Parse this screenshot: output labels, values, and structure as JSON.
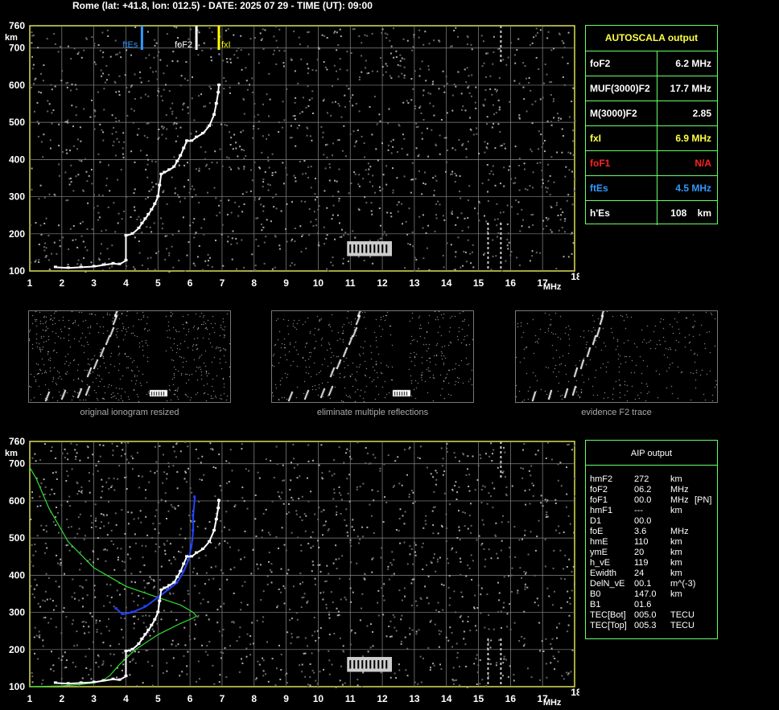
{
  "header": {
    "title": "Rome (lat: +41.8, lon: 012.5) - DATE: 2025 07 29 - TIME (UT): 09:00"
  },
  "axes": {
    "y_unit": "km",
    "x_unit": "MHz",
    "y_ticks": [
      "760",
      "700",
      "600",
      "500",
      "400",
      "300",
      "200",
      "100"
    ],
    "x_ticks": [
      "1",
      "2",
      "3",
      "4",
      "5",
      "6",
      "7",
      "8",
      "9",
      "10",
      "11",
      "12",
      "13",
      "14",
      "15",
      "16",
      "17",
      "18"
    ]
  },
  "markers": [
    {
      "label": "ftEs",
      "freq": 4.5,
      "color": "#3399ff"
    },
    {
      "label": "foF2",
      "freq": 6.2,
      "color": "#ffffff"
    },
    {
      "label": "fxI",
      "freq": 6.9,
      "color": "#ffff00"
    }
  ],
  "autoscala": {
    "title": "AUTOSCALA output",
    "rows": [
      {
        "label": "foF2",
        "value": "6.2 MHz",
        "color": "#ffffff"
      },
      {
        "label": "MUF(3000)F2",
        "value": "17.7 MHz",
        "color": "#ffffff"
      },
      {
        "label": "M(3000)F2",
        "value": "2.85",
        "color": "#ffffff"
      },
      {
        "label": "fxI",
        "value": "6.9 MHz",
        "color": "#ffff44"
      },
      {
        "label": "foF1",
        "value": "N/A",
        "color": "#ff2222"
      },
      {
        "label": "ftEs",
        "value": "4.5 MHz",
        "color": "#3399ff"
      },
      {
        "label": "h'Es",
        "value": "108    km",
        "color": "#ffffff"
      }
    ]
  },
  "thumbnails": [
    {
      "caption": "original ionogram resized"
    },
    {
      "caption": "eliminate multiple reflections"
    },
    {
      "caption": "evidence F2 trace"
    }
  ],
  "aip": {
    "title": "AIP output",
    "rows": [
      {
        "label": "hmF2",
        "value": "272",
        "unit": "km",
        "extra": ""
      },
      {
        "label": "foF2",
        "value": "06.2",
        "unit": "MHz",
        "extra": ""
      },
      {
        "label": "foF1",
        "value": "00.0",
        "unit": "MHz",
        "extra": "[PN]"
      },
      {
        "label": "hmF1",
        "value": "---",
        "unit": "km",
        "extra": ""
      },
      {
        "label": "D1",
        "value": "00.0",
        "unit": "",
        "extra": ""
      },
      {
        "label": "foE",
        "value": "3.6",
        "unit": "MHz",
        "extra": ""
      },
      {
        "label": "hmE",
        "value": "110",
        "unit": "km",
        "extra": ""
      },
      {
        "label": "ymE",
        "value": "20",
        "unit": "km",
        "extra": ""
      },
      {
        "label": "h_vE",
        "value": "119",
        "unit": "km",
        "extra": ""
      },
      {
        "label": "Ewidth",
        "value": "24",
        "unit": "km",
        "extra": ""
      },
      {
        "label": "DelN_vE",
        "value": "00.1",
        "unit": "m^(-3)",
        "extra": ""
      },
      {
        "label": "B0",
        "value": "147.0",
        "unit": "km",
        "extra": ""
      },
      {
        "label": "B1",
        "value": "01.6",
        "unit": "",
        "extra": ""
      },
      {
        "label": "TEC[Bot]",
        "value": "005.0",
        "unit": "TECU",
        "extra": ""
      },
      {
        "label": "TEC[Top]",
        "value": "005.3",
        "unit": "TECU",
        "extra": ""
      }
    ]
  },
  "chart_data": [
    {
      "type": "scatter",
      "xlim": [
        1,
        18
      ],
      "ylim": [
        100,
        760
      ],
      "grid": true,
      "series": [
        {
          "points": [
            [
              1.8,
              110
            ],
            [
              2.2,
              108
            ],
            [
              2.6,
              110
            ],
            [
              3.0,
              112
            ],
            [
              3.3,
              116
            ],
            [
              3.6,
              120
            ],
            [
              3.8,
              118
            ],
            [
              4.0,
              128
            ],
            [
              4.0,
              195
            ],
            [
              4.2,
              200
            ],
            [
              4.4,
              215
            ],
            [
              4.5,
              228
            ],
            [
              4.6,
              240
            ],
            [
              4.7,
              252
            ],
            [
              4.8,
              265
            ],
            [
              4.9,
              280
            ],
            [
              5.0,
              300
            ],
            [
              5.05,
              330
            ],
            [
              5.1,
              360
            ],
            [
              5.2,
              365
            ],
            [
              5.35,
              372
            ],
            [
              5.5,
              380
            ],
            [
              5.6,
              395
            ],
            [
              5.7,
              410
            ],
            [
              5.8,
              430
            ],
            [
              5.9,
              450
            ],
            [
              6.05,
              450
            ],
            [
              6.2,
              460
            ],
            [
              6.4,
              470
            ],
            [
              6.6,
              490
            ],
            [
              6.75,
              520
            ],
            [
              6.82,
              550
            ],
            [
              6.88,
              580
            ],
            [
              6.9,
              600
            ]
          ]
        }
      ]
    },
    {
      "type": "line",
      "xlim": [
        1,
        18
      ],
      "ylim": [
        100,
        760
      ],
      "grid": true,
      "series": [
        {
          "points": [
            [
              1.0,
              100
            ],
            [
              2.0,
              102
            ],
            [
              2.6,
              106
            ],
            [
              3.0,
              110
            ],
            [
              3.3,
              118
            ],
            [
              3.5,
              130
            ],
            [
              3.8,
              160
            ],
            [
              4.3,
              200
            ],
            [
              5.0,
              240
            ],
            [
              5.7,
              270
            ],
            [
              6.1,
              285
            ],
            [
              6.2,
              290
            ],
            [
              6.1,
              300
            ],
            [
              5.7,
              320
            ],
            [
              5.0,
              340
            ],
            [
              4.0,
              370
            ],
            [
              3.0,
              420
            ],
            [
              2.2,
              490
            ],
            [
              1.6,
              580
            ],
            [
              1.2,
              660
            ],
            [
              1.0,
              690
            ]
          ]
        },
        {
          "points": [
            [
              3.7,
              310
            ],
            [
              3.9,
              295
            ],
            [
              4.2,
              300
            ],
            [
              4.6,
              315
            ],
            [
              5.0,
              340
            ],
            [
              5.3,
              360
            ],
            [
              5.6,
              380
            ],
            [
              5.8,
              410
            ],
            [
              5.95,
              440
            ],
            [
              6.05,
              480
            ],
            [
              6.1,
              520
            ],
            [
              6.1,
              560
            ],
            [
              6.15,
              610
            ]
          ]
        },
        {
          "points": [
            [
              1.8,
              110
            ],
            [
              2.2,
              108
            ],
            [
              2.6,
              110
            ],
            [
              3.0,
              112
            ],
            [
              3.3,
              116
            ],
            [
              3.6,
              120
            ],
            [
              3.8,
              118
            ],
            [
              4.0,
              128
            ],
            [
              4.0,
              195
            ],
            [
              4.2,
              200
            ],
            [
              4.4,
              215
            ],
            [
              4.5,
              228
            ],
            [
              4.6,
              240
            ],
            [
              4.7,
              252
            ],
            [
              4.8,
              265
            ],
            [
              4.9,
              280
            ],
            [
              5.0,
              300
            ],
            [
              5.05,
              330
            ],
            [
              5.1,
              360
            ],
            [
              5.2,
              365
            ],
            [
              5.35,
              372
            ],
            [
              5.5,
              380
            ],
            [
              5.6,
              395
            ],
            [
              5.7,
              410
            ],
            [
              5.8,
              430
            ],
            [
              5.9,
              450
            ],
            [
              6.05,
              450
            ],
            [
              6.2,
              460
            ],
            [
              6.4,
              470
            ],
            [
              6.6,
              490
            ],
            [
              6.75,
              520
            ],
            [
              6.82,
              550
            ],
            [
              6.88,
              580
            ],
            [
              6.9,
              600
            ]
          ]
        }
      ]
    }
  ]
}
